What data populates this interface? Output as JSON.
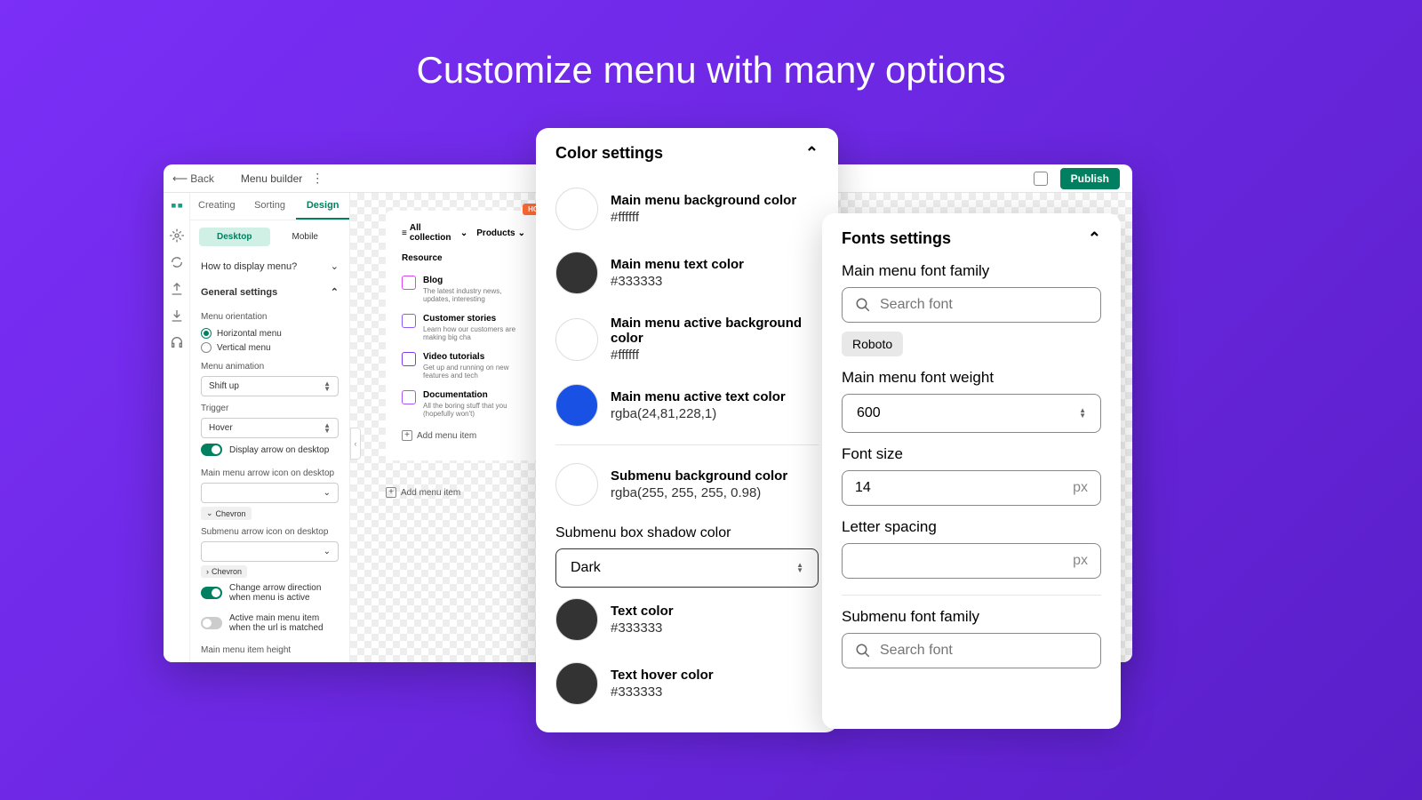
{
  "hero": {
    "title": "Customize menu with many options"
  },
  "topbar": {
    "back": "Back",
    "breadcrumb": "Menu builder",
    "publish": "Publish"
  },
  "tabs": {
    "creating": "Creating",
    "sorting": "Sorting",
    "design": "Design"
  },
  "device": {
    "desktop": "Desktop",
    "mobile": "Mobile"
  },
  "sections": {
    "display": "How to display menu?",
    "general": "General settings"
  },
  "controls": {
    "orientation_label": "Menu orientation",
    "horizontal": "Horizontal menu",
    "vertical": "Vertical menu",
    "animation_label": "Menu animation",
    "animation_value": "Shift up",
    "trigger_label": "Trigger",
    "trigger_value": "Hover",
    "display_arrow": "Display arrow on desktop",
    "main_arrow_label": "Main menu arrow icon on desktop",
    "chevron_chip": "Chevron",
    "sub_arrow_label": "Submenu arrow icon on desktop",
    "chevron_chip2": "Chevron",
    "change_arrow": "Change arrow direction when menu is active",
    "active_item": "Active main menu item when the url is matched",
    "item_height": "Main menu item height"
  },
  "canvas": {
    "hot": "HOT",
    "all_collection": "All collection",
    "products": "Products",
    "resource": "Resource",
    "items": [
      {
        "title": "Blog",
        "desc": "The latest industry news, updates, interesting",
        "color": "#d946ef"
      },
      {
        "title": "Customer stories",
        "desc": "Learn how our customers are making big cha",
        "color": "#8b5cf6"
      },
      {
        "title": "Video tutorials",
        "desc": "Get up and running on new features and tech",
        "color": "#7c3aed"
      },
      {
        "title": "Documentation",
        "desc": "All the boring stuff that you (hopefully won't)",
        "color": "#a855f7"
      }
    ],
    "add_item": "Add menu item"
  },
  "color_panel": {
    "title": "Color settings",
    "items": [
      {
        "name": "Main menu background color",
        "value": "#ffffff",
        "swatch": "#ffffff"
      },
      {
        "name": "Main menu text color",
        "value": "#333333",
        "swatch": "#333333"
      },
      {
        "name": "Main menu active background color",
        "value": "#ffffff",
        "swatch": "#ffffff"
      },
      {
        "name": "Main menu active text color",
        "value": "rgba(24,81,228,1)",
        "swatch": "rgb(24,81,228)"
      }
    ],
    "submenu_bg": {
      "name": "Submenu background color",
      "value": "rgba(255, 255, 255, 0.98)",
      "swatch": "#ffffff"
    },
    "shadow_label": "Submenu box shadow color",
    "shadow_value": "Dark",
    "text_color": {
      "name": "Text color",
      "value": "#333333",
      "swatch": "#333333"
    },
    "text_hover": {
      "name": "Text hover color",
      "value": "#333333",
      "swatch": "#333333"
    }
  },
  "fonts_panel": {
    "title": "Fonts settings",
    "main_family": "Main menu font family",
    "search_placeholder": "Search font",
    "roboto": "Roboto",
    "weight_label": "Main menu font weight",
    "weight_value": "600",
    "size_label": "Font size",
    "size_value": "14",
    "px": "px",
    "spacing_label": "Letter spacing",
    "submenu_family": "Submenu font family"
  }
}
